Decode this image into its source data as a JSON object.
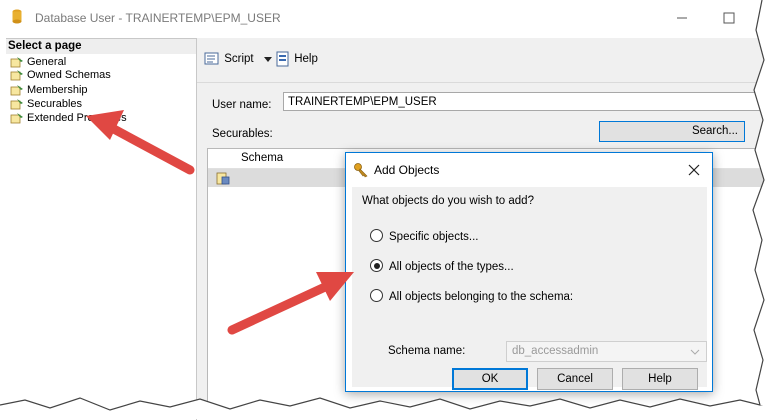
{
  "window": {
    "title": "Database User - TRAINERTEMP\\EPM_USER",
    "minimize_icon": "minimize-icon",
    "maximize_icon": "maximize-icon"
  },
  "left_panel": {
    "header": "Select a page",
    "items": [
      {
        "label": "General",
        "icon": "page-icon"
      },
      {
        "label": "Owned Schemas",
        "icon": "page-icon"
      },
      {
        "label": "Membership",
        "icon": "page-icon"
      },
      {
        "label": "Securables",
        "icon": "page-icon"
      },
      {
        "label": "Extended Properties",
        "icon": "page-icon"
      }
    ]
  },
  "toolbar": {
    "script_label": "Script",
    "help_label": "Help"
  },
  "form": {
    "username_label": "User name:",
    "username_value": "TRAINERTEMP\\EPM_USER",
    "securables_label": "Securables:",
    "search_label": "Search...",
    "grid_column_schema": "Schema"
  },
  "dialog": {
    "title": "Add Objects",
    "question": "What objects do you wish to add?",
    "options": [
      {
        "label": "Specific objects...",
        "selected": false
      },
      {
        "label": "All objects of the types...",
        "selected": true
      },
      {
        "label": "All objects belonging to the schema:",
        "selected": false
      }
    ],
    "schema_name_label": "Schema name:",
    "schema_name_value": "db_accessadmin",
    "ok_label": "OK",
    "cancel_label": "Cancel",
    "help_label": "Help"
  },
  "colors": {
    "accent": "#0078d7",
    "arrow": "#e04843",
    "panel_bg": "#f0f0f0"
  }
}
